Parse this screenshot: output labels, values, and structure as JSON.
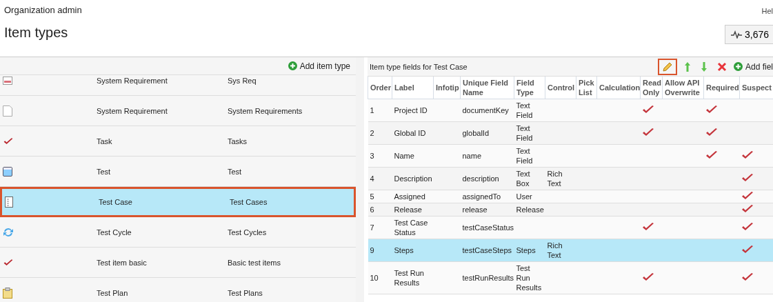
{
  "header": {
    "breadcrumb": "Organization admin",
    "title": "Item types",
    "help": "Hel",
    "activity_count": "3,676"
  },
  "item_types": {
    "add_button": "Add item type",
    "rows": [
      {
        "kind": "bar",
        "name": "System Requirement",
        "plural": "Sys Req",
        "selected": false
      },
      {
        "kind": "page",
        "name": "System Requirement",
        "plural": "System Requirements",
        "selected": false
      },
      {
        "kind": "check",
        "name": "Task",
        "plural": "Tasks",
        "selected": false
      },
      {
        "kind": "window",
        "name": "Test",
        "plural": "Test",
        "selected": false
      },
      {
        "kind": "list",
        "name": "Test Case",
        "plural": "Test Cases",
        "selected": true
      },
      {
        "kind": "cycle",
        "name": "Test Cycle",
        "plural": "Test Cycles",
        "selected": false
      },
      {
        "kind": "check",
        "name": "Test item basic",
        "plural": "Basic test items",
        "selected": false
      },
      {
        "kind": "clipboard",
        "name": "Test Plan",
        "plural": "Test Plans",
        "selected": false
      }
    ]
  },
  "fields": {
    "title": "Item type fields for Test Case",
    "add_button": "Add fiel",
    "columns": [
      "Order",
      "Label",
      "Infotip",
      "Unique Field Name",
      "Field Type",
      "Control",
      "Pick List",
      "Calculation",
      "Read Only",
      "Allow API Overwrite",
      "Required",
      "Suspect"
    ],
    "rows": [
      {
        "order": "1",
        "label": "Project ID",
        "unique_name": "documentKey",
        "field_type": "Text Field",
        "control": "",
        "read_only": true,
        "required": true,
        "suspect": false,
        "selected": false
      },
      {
        "order": "2",
        "label": "Global ID",
        "unique_name": "globalId",
        "field_type": "Text Field",
        "control": "",
        "read_only": true,
        "required": true,
        "suspect": false,
        "selected": false
      },
      {
        "order": "3",
        "label": "Name",
        "unique_name": "name",
        "field_type": "Text Field",
        "control": "",
        "read_only": false,
        "required": true,
        "suspect": true,
        "selected": false
      },
      {
        "order": "4",
        "label": "Description",
        "unique_name": "description",
        "field_type": "Text Box",
        "control": "Rich Text",
        "read_only": false,
        "required": false,
        "suspect": true,
        "selected": false
      },
      {
        "order": "5",
        "label": "Assigned",
        "unique_name": "assignedTo",
        "field_type": "User",
        "control": "",
        "read_only": false,
        "required": false,
        "suspect": true,
        "selected": false
      },
      {
        "order": "6",
        "label": "Release",
        "unique_name": "release",
        "field_type": "Release",
        "control": "",
        "read_only": false,
        "required": false,
        "suspect": true,
        "selected": false
      },
      {
        "order": "7",
        "label": "Test Case Status",
        "unique_name": "testCaseStatus",
        "field_type": "",
        "control": "",
        "read_only": true,
        "required": false,
        "suspect": true,
        "selected": false
      },
      {
        "order": "9",
        "label": "Steps",
        "unique_name": "testCaseSteps",
        "field_type": "Steps",
        "control": "Rich Text",
        "read_only": false,
        "required": false,
        "suspect": true,
        "selected": true
      },
      {
        "order": "10",
        "label": "Test Run Results",
        "unique_name": "testRunResults",
        "field_type": "Test Run Results",
        "control": "",
        "read_only": true,
        "required": false,
        "suspect": true,
        "selected": false
      }
    ]
  }
}
